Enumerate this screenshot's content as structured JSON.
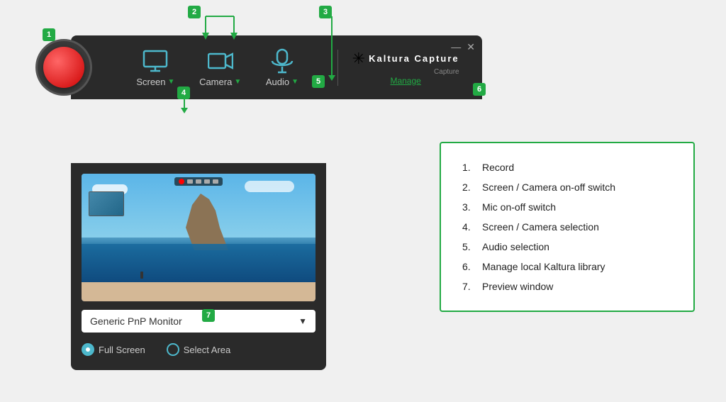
{
  "app": {
    "title": "Kaltura Capture"
  },
  "toolbar": {
    "record_label": "Record",
    "screen_label": "Screen",
    "camera_label": "Camera",
    "audio_label": "Audio",
    "manage_label": "Manage",
    "kaltura_name": "KALTURA",
    "kaltura_sub": "Capture",
    "minimize": "—",
    "close": "✕"
  },
  "badges": {
    "b1": "1",
    "b2": "2",
    "b3": "3",
    "b4": "4",
    "b5": "5",
    "b6": "6",
    "b7": "7"
  },
  "dropdown": {
    "monitor_label": "Generic PnP Monitor",
    "full_screen": "Full Screen",
    "select_area": "Select Area"
  },
  "info_items": [
    {
      "num": "1.",
      "text": "Record"
    },
    {
      "num": "2.",
      "text": "Screen / Camera on-off switch"
    },
    {
      "num": "3.",
      "text": "Mic on-off switch"
    },
    {
      "num": "4.",
      "text": "Screen / Camera selection"
    },
    {
      "num": "5.",
      "text": "Audio selection"
    },
    {
      "num": "6.",
      "text": "Manage local Kaltura library"
    },
    {
      "num": "7.",
      "text": "Preview window"
    }
  ]
}
